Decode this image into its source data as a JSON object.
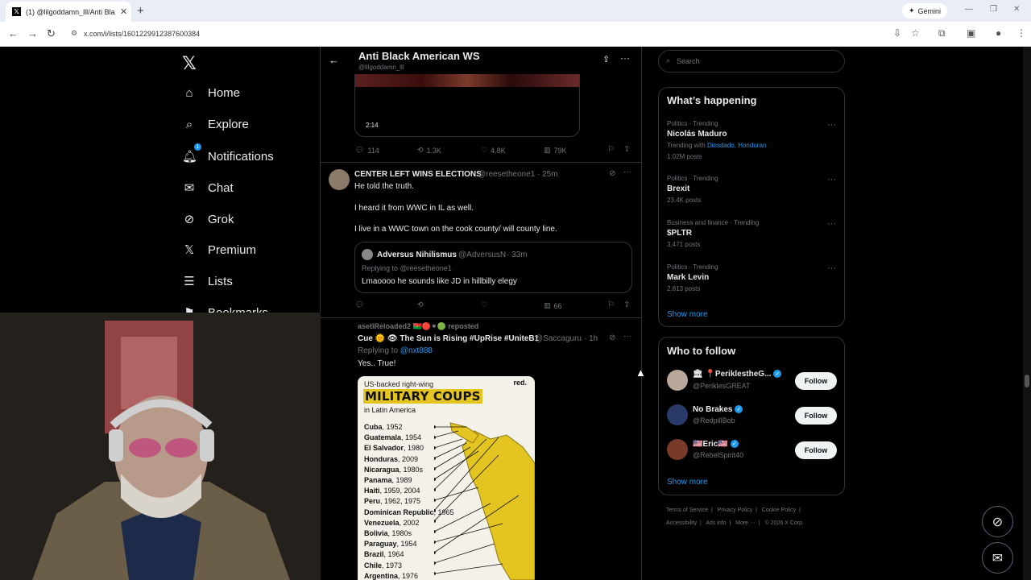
{
  "browser": {
    "tab_title": "(1) @lilgoddamn_lll/Anti Black",
    "url": "x.com/i/lists/1601229912387600384",
    "gemini_label": "Gemini"
  },
  "nav": {
    "items": [
      {
        "label": "Home",
        "icon": "home-icon"
      },
      {
        "label": "Explore",
        "icon": "search-icon"
      },
      {
        "label": "Notifications",
        "icon": "bell-icon",
        "badge": "1"
      },
      {
        "label": "Chat",
        "icon": "mail-icon"
      },
      {
        "label": "Grok",
        "icon": "grok-icon"
      },
      {
        "label": "Premium",
        "icon": "x-icon"
      },
      {
        "label": "Lists",
        "icon": "list-icon"
      },
      {
        "label": "Bookmarks",
        "icon": "bookmark-icon"
      }
    ]
  },
  "list_header": {
    "title": "Anti Black American WS",
    "handle": "@lilgoddamn_lll"
  },
  "tweet1": {
    "video_duration": "2:14",
    "replies": "114",
    "reposts": "1.3K",
    "likes": "4.8K",
    "views": "79K"
  },
  "tweet2": {
    "name": "CENTER LEFT WINS ELECTIONS",
    "handle": "@reesetheone1",
    "time": "· 25m",
    "lines": [
      "He told the truth.",
      "I heard it from WWC in IL as well.",
      "I live in a WWC town on the cook county/ will county line."
    ],
    "quote": {
      "name": "Adversus Nihilismus",
      "handle": "@AdversusN",
      "time": "· 33m",
      "replying_to": "Replying to @reesetheone1",
      "text": "Lmaoooo he sounds like JD in hillbilly elegy"
    },
    "views": "66"
  },
  "tweet3": {
    "reposted_by": "asetlReloaded2 🇧🇫🔴⚫🟢 reposted",
    "name": "Cue 🌞 👁 The Sun is Rising #UpRise #UniteB1",
    "handle": "@Saccaguru",
    "time": "· 1h",
    "replying_label": "Replying to ",
    "replying_to": "@nxt888",
    "text": "Yes.. True!",
    "image": {
      "subtitle": "US-backed right-wing",
      "brand": "red.",
      "headline": "MILITARY COUPS",
      "region": "in Latin America",
      "rows": [
        {
          "country": "Cuba",
          "years": ", 1952"
        },
        {
          "country": "Guatemala",
          "years": ", 1954"
        },
        {
          "country": "El Salvador",
          "years": ", 1980"
        },
        {
          "country": "Honduras",
          "years": ", 2009"
        },
        {
          "country": "Nicaragua",
          "years": ", 1980s"
        },
        {
          "country": "Panama",
          "years": ", 1989"
        },
        {
          "country": "Haiti",
          "years": ", 1959, 2004"
        },
        {
          "country": "Peru",
          "years": ", 1962, 1975"
        },
        {
          "country": "Dominican Republic",
          "years": ", 1965"
        },
        {
          "country": "Venezuela",
          "years": ", 2002"
        },
        {
          "country": "Bolivia",
          "years": ", 1980s"
        },
        {
          "country": "Paraguay",
          "years": ", 1954"
        },
        {
          "country": "Brazil",
          "years": ", 1964"
        },
        {
          "country": "Chile",
          "years": ", 1973"
        },
        {
          "country": "Argentina",
          "years": ", 1976"
        }
      ]
    }
  },
  "sidebar": {
    "search_placeholder": "Search",
    "whats_happening": "What’s happening",
    "trends": [
      {
        "category": "Politics · Trending",
        "name": "Nicolás Maduro",
        "with_label": "Trending with ",
        "with_links": "Diosdado, Honduran",
        "posts": "1.02M posts"
      },
      {
        "category": "Politics · Trending",
        "name": "Brexit",
        "posts": "23.4K posts"
      },
      {
        "category": "Business and finance · Trending",
        "name": "$PLTR",
        "posts": "3,471 posts"
      },
      {
        "category": "Politics · Trending",
        "name": "Mark Levin",
        "posts": "2,813 posts"
      }
    ],
    "show_more": "Show more",
    "who_to_follow": "Who to follow",
    "follow_suggestions": [
      {
        "name": "🏛 📍PeriklestheG...",
        "handle": "@PeriklesGREAT",
        "button": "Follow"
      },
      {
        "name": "No Brakes",
        "handle": "@RedpillBob",
        "button": "Follow"
      },
      {
        "name": "🇺🇸Eric🇺🇸",
        "handle": "@RebelSpirit40",
        "button": "Follow"
      }
    ],
    "footer_line1": [
      "Terms of Service",
      "Privacy Policy",
      "Cookie Policy"
    ],
    "footer_line2": [
      "Accessibility",
      "Ads info",
      "More ···",
      "© 2026 X Corp."
    ]
  },
  "colors": {
    "accent": "#1d9bf0",
    "background": "#000000",
    "border": "#2f3336",
    "muted": "#71767b"
  }
}
